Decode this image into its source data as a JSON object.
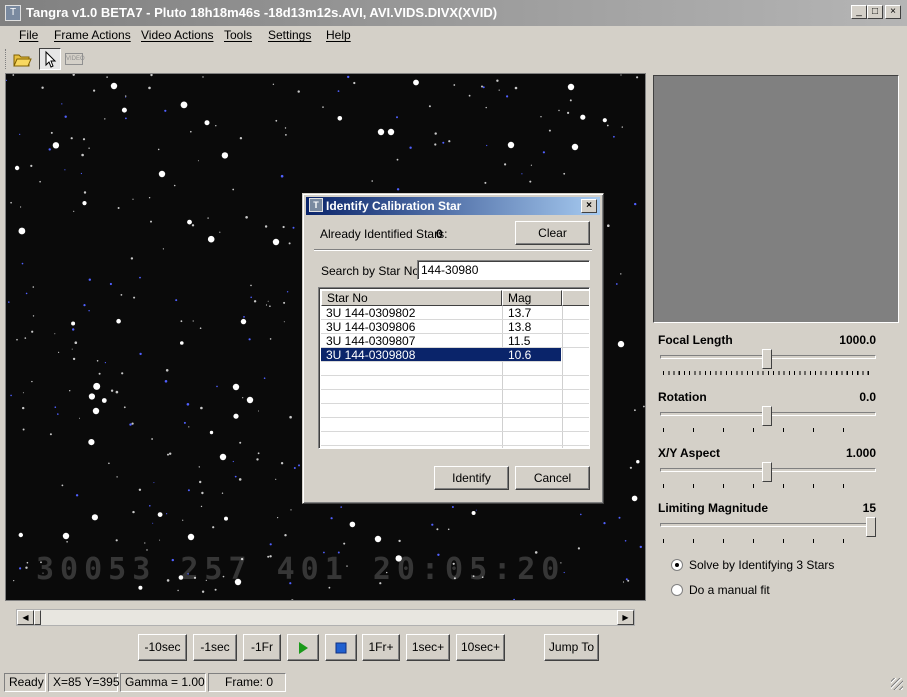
{
  "window": {
    "title": "Tangra v1.0 BETA7 - Pluto 18h18m46s -18d13m12s.AVI, AVI.VIDS.DIVX(XVID)",
    "icon": "tangra-app-icon"
  },
  "menu": [
    "File",
    "Frame Actions",
    "Video Actions",
    "Tools",
    "Settings",
    "Help"
  ],
  "toolbar": {
    "icons": [
      "open-folder-icon",
      "select-arrow-icon",
      "video-disabled-icon"
    ],
    "video_label": "VIDEO"
  },
  "video": {
    "overlay_text": "30053 257 401 20:05:20"
  },
  "playback": {
    "buttons": [
      "-10sec",
      "-1sec",
      "-1Fr",
      "play",
      "stop",
      "1Fr+",
      "1sec+",
      "10sec+"
    ],
    "jump_label": "Jump To"
  },
  "sliders": [
    {
      "label": "Focal Length",
      "value": "1000.0",
      "position": 0.5
    },
    {
      "label": "Rotation",
      "value": "0.0",
      "position": 0.5
    },
    {
      "label": "X/Y Aspect",
      "value": "1.000",
      "position": 0.5
    },
    {
      "label": "Limiting Magnitude",
      "value": "15",
      "position": 1.0
    }
  ],
  "radios": [
    {
      "label": "Solve by Identifying 3 Stars",
      "checked": true
    },
    {
      "label": "Do a manual fit",
      "checked": false
    }
  ],
  "status": {
    "ready": "Ready",
    "coords": "X=85 Y=395",
    "gamma": "Gamma = 1.00",
    "frame": "Frame: 0"
  },
  "dialog": {
    "title": "Identify Calibration Star",
    "identified_label": "Already Identified Stars:",
    "identified_count": "0",
    "clear_label": "Clear",
    "search_label": "Search by Star No:",
    "search_value": "144-30980",
    "columns": [
      "Star No",
      "Mag"
    ],
    "rows": [
      {
        "star": "3U 144-0309802",
        "mag": "13.7"
      },
      {
        "star": "3U 144-0309806",
        "mag": "13.8"
      },
      {
        "star": "3U 144-0309807",
        "mag": "11.5"
      },
      {
        "star": "3U 144-0309808",
        "mag": "10.6"
      }
    ],
    "selected_row": 3,
    "identify_label": "Identify",
    "cancel_label": "Cancel"
  },
  "colors": {
    "face": "#d4d0c8",
    "active_title": "#0a246a",
    "inactive_title": "#808080",
    "selection": "#0a246a",
    "preview": "#808080",
    "play_green": "#1a9a1a",
    "stop_blue": "#2060d0"
  }
}
